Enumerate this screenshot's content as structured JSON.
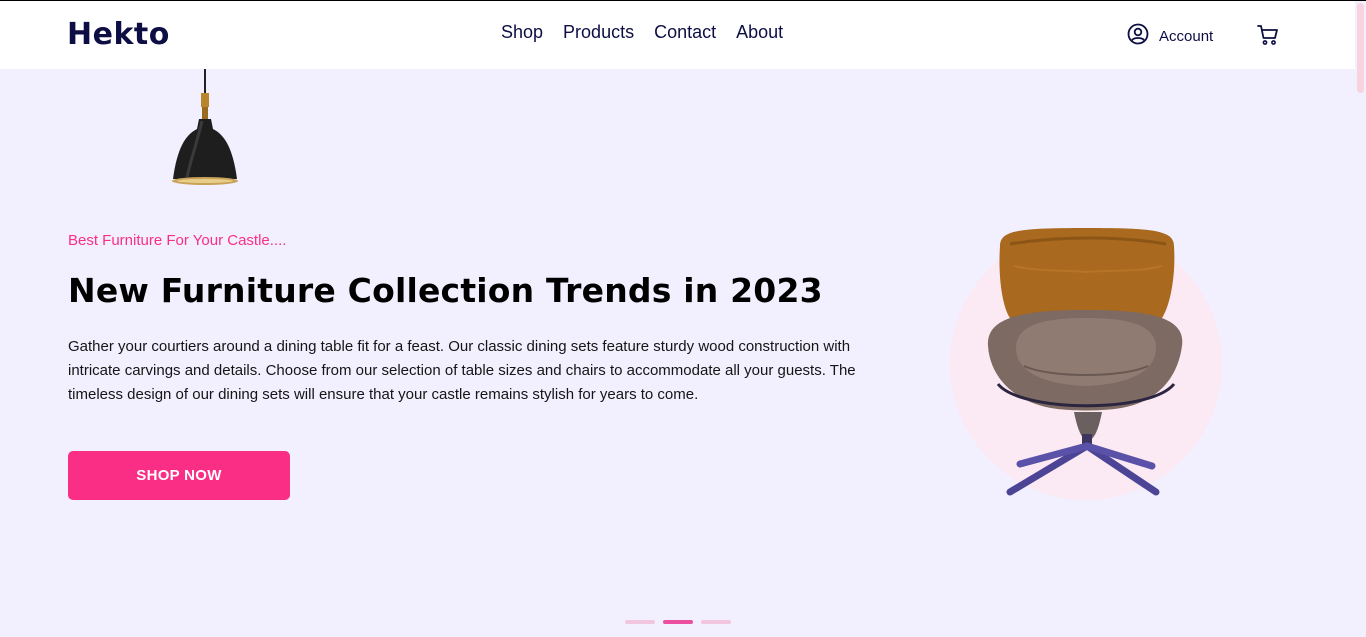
{
  "header": {
    "logo": "Hekto",
    "nav": [
      {
        "label": "Shop"
      },
      {
        "label": "Products"
      },
      {
        "label": "Contact"
      },
      {
        "label": "About"
      }
    ],
    "account_label": "Account"
  },
  "hero": {
    "tagline": "Best Furniture For Your Castle....",
    "title": "New Furniture Collection Trends in 2023",
    "description": "Gather your courtiers around a dining table fit for a feast. Our classic dining sets feature sturdy wood construction with intricate carvings and details. Choose from our selection of table sizes and chairs to accommodate all your guests. The timeless design of our dining sets will ensure that your castle remains stylish for years to come.",
    "cta_label": "SHOP NOW"
  },
  "carousel": {
    "slides": 3,
    "active_index": 1
  },
  "colors": {
    "accent": "#FB2E86",
    "brand_navy": "#0D0E43",
    "hero_background": "#F2F0FF",
    "circle": "#FBE9F3"
  },
  "icons": [
    "user-circle-icon",
    "cart-icon",
    "pendant-lamp-image",
    "lounge-chair-image"
  ]
}
